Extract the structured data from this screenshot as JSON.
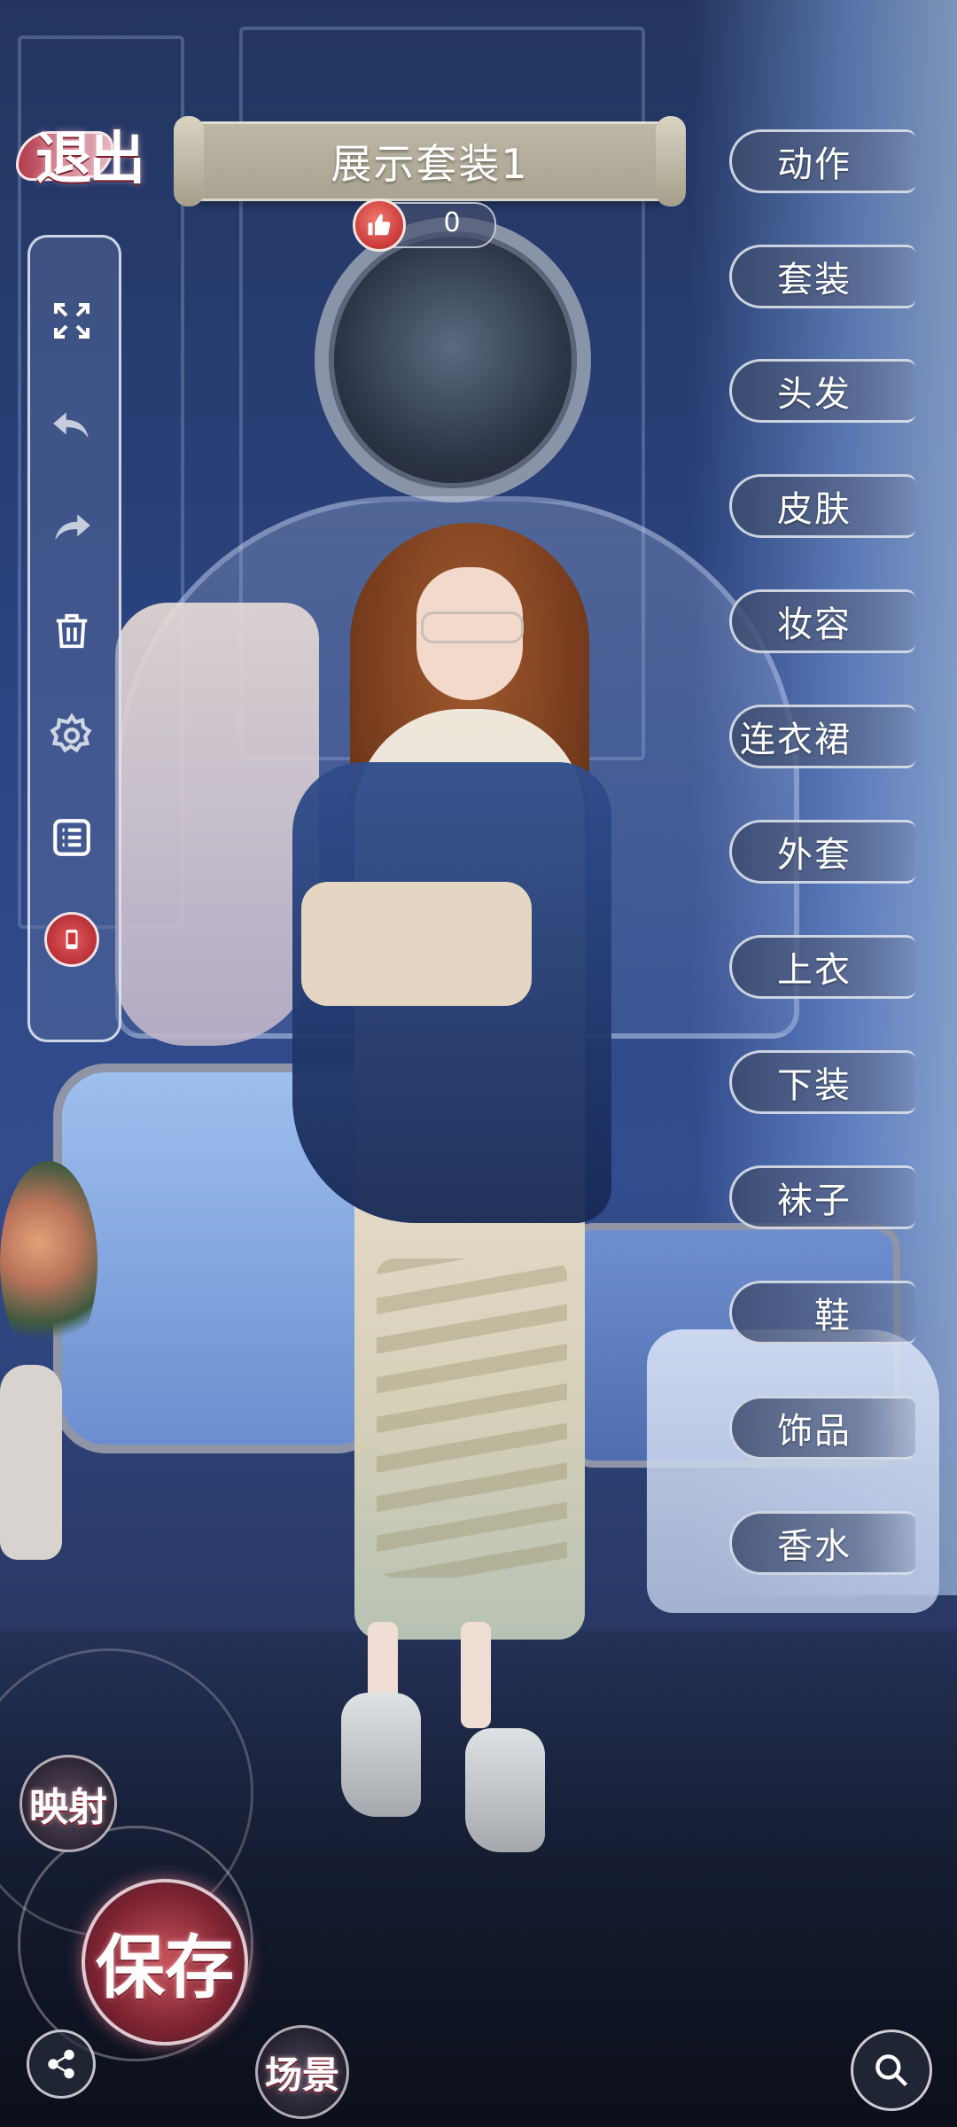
{
  "header": {
    "exit_label": "退出",
    "outfit_title": "展示套装1",
    "like_count": "0"
  },
  "toolbar": {
    "items": [
      {
        "name": "fullscreen",
        "icon": "expand-icon"
      },
      {
        "name": "undo",
        "icon": "undo-icon"
      },
      {
        "name": "redo",
        "icon": "redo-icon"
      },
      {
        "name": "delete",
        "icon": "trash-icon"
      },
      {
        "name": "settings",
        "icon": "gear-icon"
      },
      {
        "name": "list",
        "icon": "list-icon"
      },
      {
        "name": "phone",
        "icon": "phone-icon"
      }
    ]
  },
  "categories": [
    "动作",
    "套装",
    "头发",
    "皮肤",
    "妆容",
    "连衣裙",
    "外套",
    "上衣",
    "下装",
    "袜子",
    "鞋",
    "饰品",
    "香水"
  ],
  "bottom": {
    "map_label": "映射",
    "save_label": "保存",
    "scene_label": "场景"
  },
  "colors": {
    "accent_red": "#c9393a",
    "panel_border": "#e6ebf5",
    "banner": "#b3ad9b"
  }
}
